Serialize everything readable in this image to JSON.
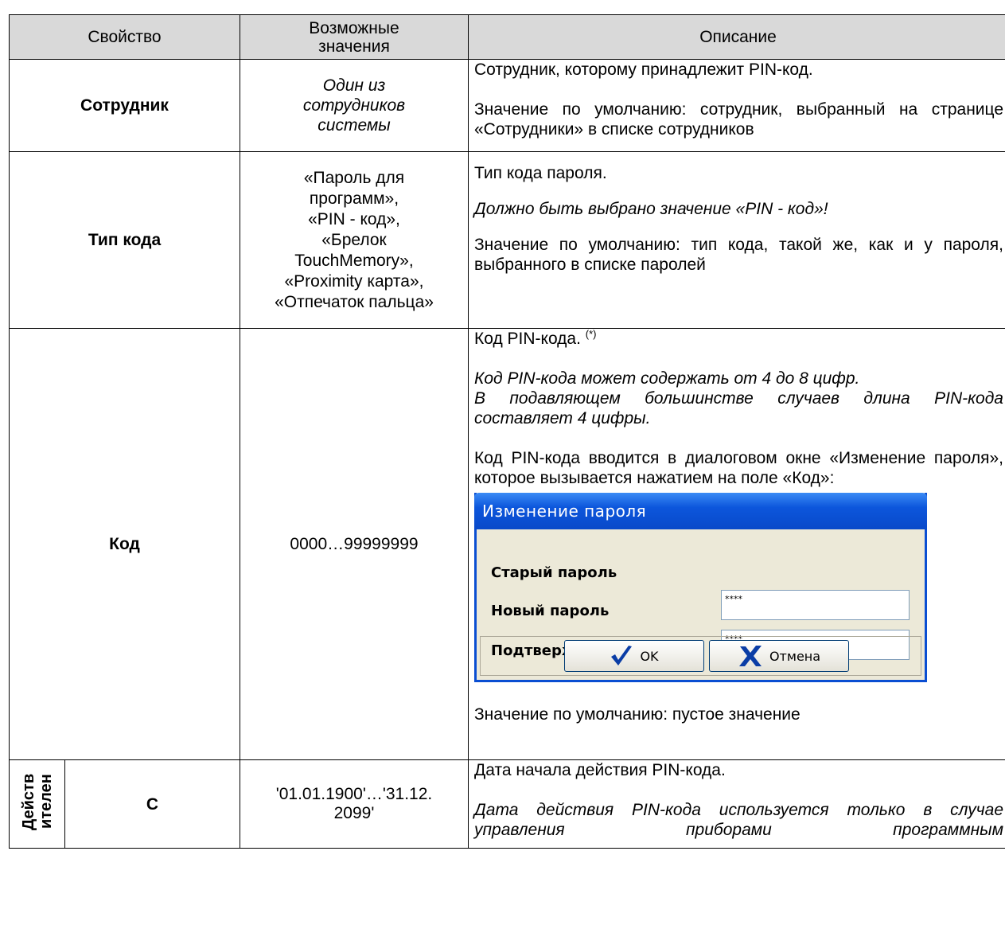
{
  "headers": {
    "property": "Свойство",
    "values": "Возможные значения",
    "description": "Описание"
  },
  "rows": {
    "employee": {
      "name": "Сотрудник",
      "values": "Один из сотрудников системы",
      "desc1": "Сотрудник, которому принадлежит PIN-код.",
      "desc2": "Значение по умолчанию: сотрудник, выбранный на странице «Сотрудники» в списке сотрудников"
    },
    "code_type": {
      "name": "Тип кода",
      "values": "«Пароль для программ», «PIN - код», «Брелок TouchMemory», «Proximity карта», «Отпечаток пальца»",
      "desc1": "Тип кода пароля.",
      "desc2": "Должно быть выбрано значение «PIN - код»!",
      "desc3": "Значение по умолчанию: тип кода, такой же, как и у пароля, выбранного в списке паролей"
    },
    "code": {
      "name": "Код",
      "values": "0000…99999999",
      "desc1": "Код PIN-кода.",
      "footnote_mark": "(*)",
      "desc2": "Код PIN-кода может содержать от 4 до 8 цифр.",
      "desc3": "В подавляющем большинстве случаев длина PIN-кода составляет 4 цифры.",
      "desc4": "Код PIN-кода вводится в диалоговом окне «Изменение пароля», которое вызывается нажатием на поле «Код»:",
      "desc5": "Значение по умолчанию: пустое значение"
    },
    "from": {
      "group": "Действителен",
      "name": "С",
      "values": "'01.01.1900'…'31.12.2099'",
      "desc1": "Дата начала действия PIN-кода.",
      "desc2": "Дата действия PIN-кода используется только в случае управления приборами программным"
    }
  },
  "dialog": {
    "title": "Изменение пароля",
    "old_label": "Старый пароль",
    "new_label": "Новый пароль",
    "new_value": "****",
    "confirm_label": "Подтверждение пароля",
    "confirm_value": "****",
    "ok_label": "OK",
    "cancel_label": "Отмена"
  },
  "colors": {
    "header_bg": "#d9d9d9",
    "dialog_title": "#0c56dc",
    "dialog_bg": "#ece9d8"
  }
}
